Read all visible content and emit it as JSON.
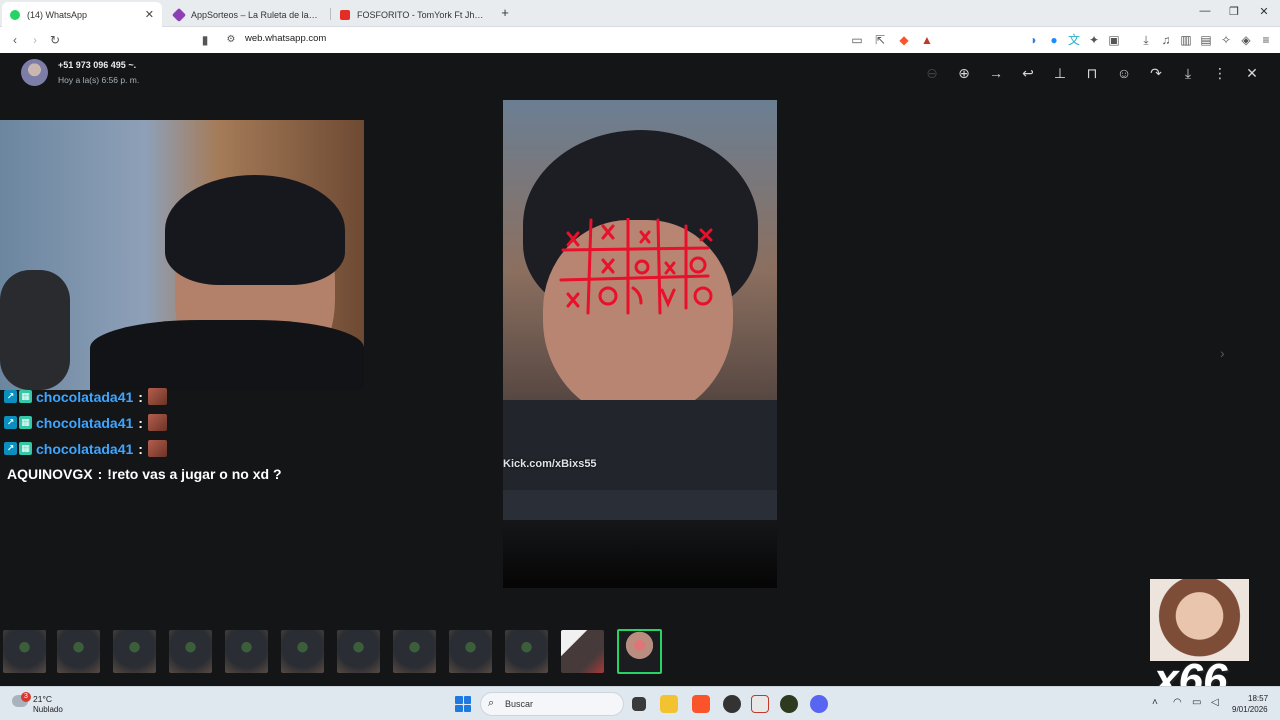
{
  "browser": {
    "tabs": [
      {
        "label": "(14) WhatsApp",
        "active": true,
        "color": "#25d366"
      },
      {
        "label": "AppSorteos – La Ruleta de la Suerte",
        "active": false,
        "color": "#8e3fb5"
      },
      {
        "label": "FOSFORITO - TomYork Ft Jhowix, El C",
        "active": false,
        "color": "#e52d27"
      }
    ],
    "new_tab": "+",
    "url": "web.whatsapp.com"
  },
  "viewer": {
    "contact_name": "+51 973 096 495 ~.",
    "contact_time": "Hoy a la(s) 6:56 p. m.",
    "watermark": "Kick.com/xBixs55",
    "accent_color": "#25d366"
  },
  "chat": {
    "messages": [
      {
        "user": "chocolatada41",
        "separator": ":",
        "text": ""
      },
      {
        "user": "chocolatada41",
        "separator": ":",
        "text": ""
      },
      {
        "user": "chocolatada41",
        "separator": ":",
        "text": ""
      },
      {
        "user": "AQUINOVGX",
        "separator": ":",
        "text": "!reto vas a jugar o no xd ?"
      }
    ]
  },
  "emote": {
    "counter": "x66"
  },
  "taskbar": {
    "weather_temp": "21°C",
    "weather_desc": "Nublado",
    "weather_badge": "3",
    "search_placeholder": "Buscar",
    "time": "18:57",
    "date": "9/01/2026"
  }
}
